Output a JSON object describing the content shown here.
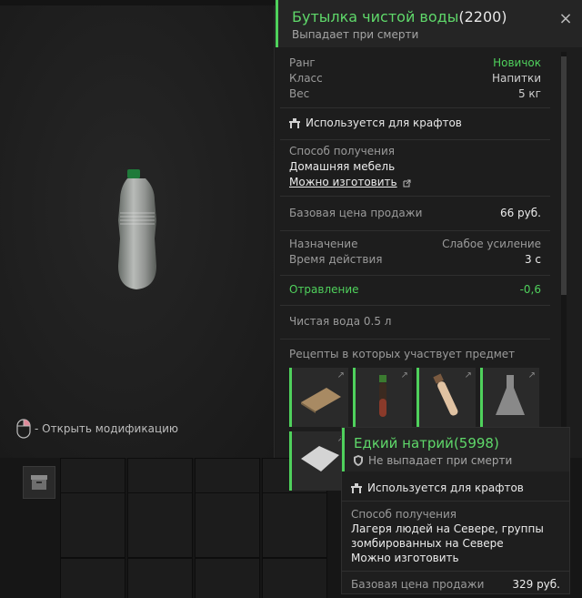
{
  "item": {
    "name": "Бутылка чистой воды",
    "id": "(2200)",
    "drop": "Выпадает при смерти",
    "close_glyph": "×"
  },
  "stats": [
    {
      "label": "Ранг",
      "value": "Новичок",
      "color": "#4fd15c"
    },
    {
      "label": "Класс",
      "value": "Напитки"
    },
    {
      "label": "Вес",
      "value": "5 кг"
    }
  ],
  "crafting_label": "Используется для крафтов",
  "obtain": {
    "label": "Способ получения",
    "source": "Домашняя мебель",
    "craft_link": "Можно изготовить"
  },
  "price": {
    "label": "Базовая цена продажи",
    "value": "66 руб."
  },
  "purpose": {
    "label": "Назначение",
    "value": "Слабое усиление",
    "duration_label": "Время действия",
    "duration_value": "3 с"
  },
  "effect": {
    "label": "Отравление",
    "value": "-0,6"
  },
  "description": "Чистая вода 0.5 л",
  "recipes_label": "Рецепты в которых участвует предмет",
  "hint_text": "- Открыть модификацию",
  "tooltip": {
    "name": "Едкий натрий",
    "id": "(5998)",
    "drop": "Не выпадает при смерти",
    "crafting_label": "Используется для крафтов",
    "obtain_label": "Способ получения",
    "obtain_line1": "Лагеря людей на Севере, группы",
    "obtain_line2": "зомбированных на Севере",
    "obtain_line3": "Можно изготовить",
    "price_label": "Базовая цена продажи",
    "price_value": "329 руб."
  },
  "colors": {
    "accent": "#4fd15c",
    "bg": "#1d1d1d"
  }
}
